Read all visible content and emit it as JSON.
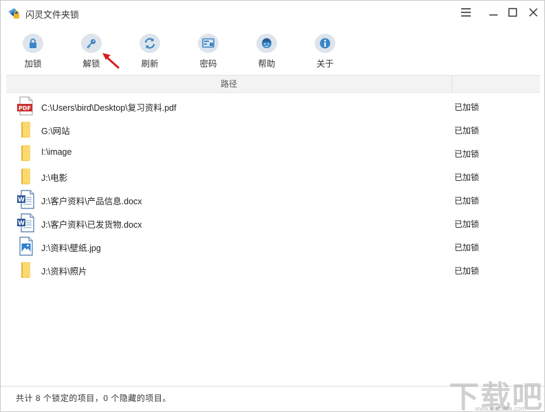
{
  "window": {
    "title": "闪灵文件夹锁",
    "controls": [
      "menu-icon",
      "minimize-icon",
      "maximize-icon",
      "close-icon"
    ]
  },
  "toolbar": {
    "items": [
      {
        "label": "加锁",
        "icon": "lock-icon"
      },
      {
        "label": "解锁",
        "icon": "key-icon"
      },
      {
        "label": "刷新",
        "icon": "refresh-icon"
      },
      {
        "label": "密码",
        "icon": "password-icon"
      },
      {
        "label": "帮助",
        "icon": "help-icon"
      },
      {
        "label": "关于",
        "icon": "info-icon"
      }
    ],
    "accent_color": "#3a86c8"
  },
  "table": {
    "columns": [
      "路径",
      ""
    ],
    "rows": [
      {
        "path": "C:\\Users\\bird\\Desktop\\复习资料.pdf",
        "status": "已加锁",
        "icon": "pdf-file-icon"
      },
      {
        "path": "G:\\网站",
        "status": "已加锁",
        "icon": "folder-icon"
      },
      {
        "path": "I:\\image",
        "status": "已加锁",
        "icon": "folder-icon"
      },
      {
        "path": "J:\\电影",
        "status": "已加锁",
        "icon": "folder-icon"
      },
      {
        "path": "J:\\客户资料\\产品信息.docx",
        "status": "已加锁",
        "icon": "word-file-icon"
      },
      {
        "path": "J:\\客户资料\\已发货物.docx",
        "status": "已加锁",
        "icon": "word-file-icon"
      },
      {
        "path": "J:\\资料\\壁纸.jpg",
        "status": "已加锁",
        "icon": "image-file-icon"
      },
      {
        "path": "J:\\资料\\照片",
        "status": "已加锁",
        "icon": "folder-icon"
      }
    ]
  },
  "statusbar": {
    "text": "共计 8 个锁定的项目，0 个隐藏的项目。"
  },
  "watermark": {
    "text": "下载吧",
    "sub": "www.xiazaiba.com"
  }
}
